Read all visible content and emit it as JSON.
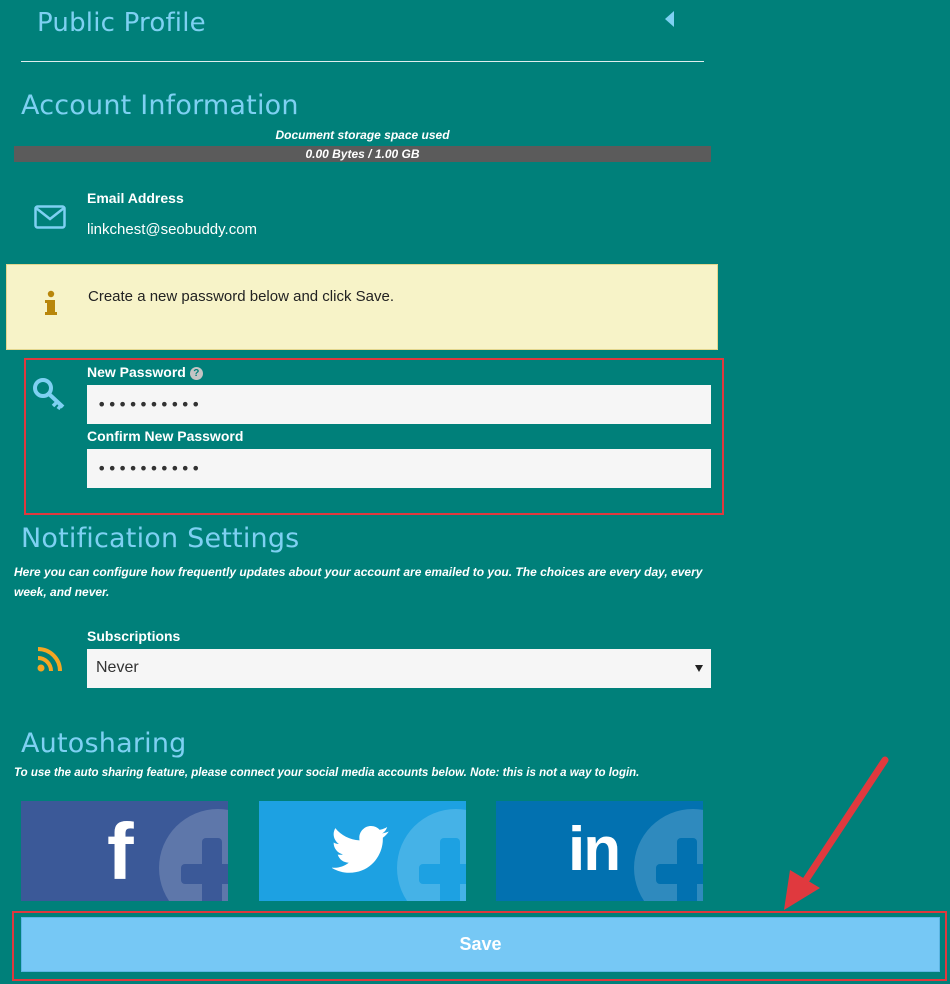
{
  "public_profile": {
    "title": "Public Profile"
  },
  "account": {
    "title": "Account Information",
    "storage_caption": "Document storage space used",
    "storage_text": "0.00 Bytes / 1.00 GB",
    "storage_used_fraction": 0.0,
    "email_label": "Email Address",
    "email_value": "linkchest@seobuddy.com"
  },
  "notice": {
    "text": "Create a new password below and click Save."
  },
  "password": {
    "new_label": "New Password",
    "help_glyph": "?",
    "new_value": "••••••••••",
    "confirm_label": "Confirm New Password",
    "confirm_value": "••••••••••"
  },
  "notifications": {
    "title": "Notification Settings",
    "description": "Here you can configure how frequently updates about your account are emailed to you. The choices are every day, every week, and never.",
    "subscriptions_label": "Subscriptions",
    "subscriptions_value": "Never"
  },
  "autosharing": {
    "title": "Autosharing",
    "description": "To use the auto sharing feature, please connect your social media accounts below. Note: this is not a way to login.",
    "facebook_glyph": "f",
    "linkedin_glyph": "in"
  },
  "save": {
    "label": "Save"
  },
  "colors": {
    "background": "#00807a",
    "heading": "#7ed0f2",
    "notice_bg": "#f7f3c8",
    "highlight": "#e0393e",
    "facebook": "#3b5998",
    "twitter": "#1da1e2",
    "linkedin": "#0271b0",
    "save_button": "#76c8f5"
  },
  "icons": [
    "collapse-arrow-icon",
    "envelope-icon",
    "info-icon",
    "key-icon",
    "help-icon",
    "rss-icon",
    "facebook-icon",
    "twitter-icon",
    "linkedin-icon"
  ]
}
